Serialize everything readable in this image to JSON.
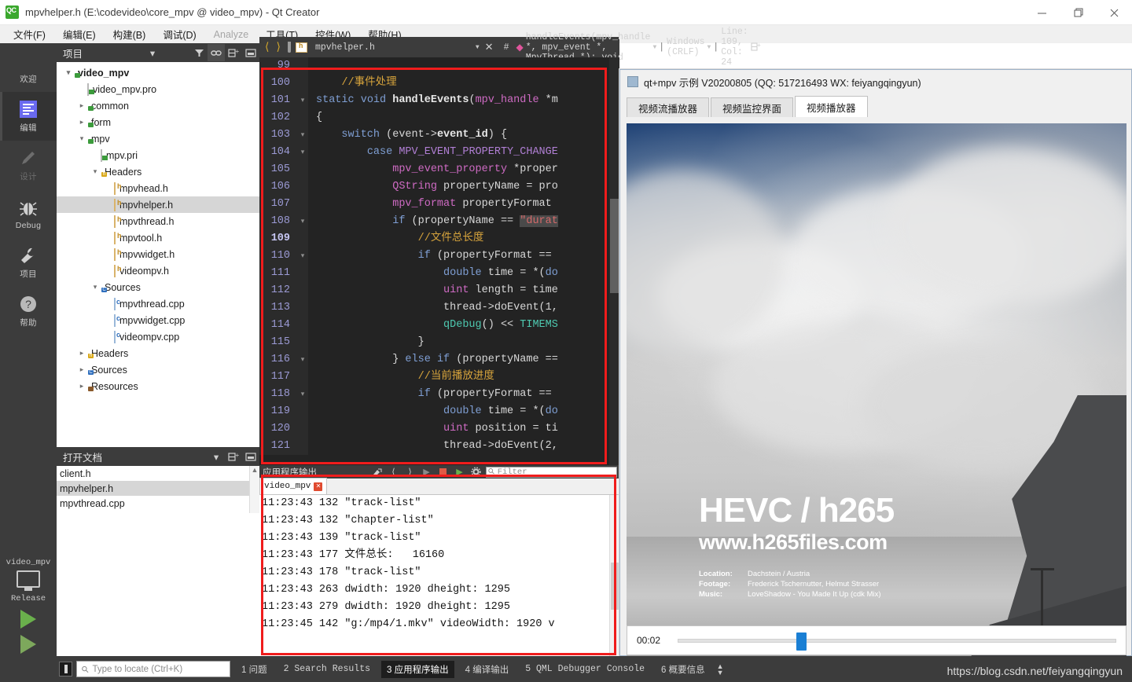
{
  "window": {
    "title": "mpvhelper.h (E:\\codevideo\\core_mpv @ video_mpv) - Qt Creator",
    "minimize": "—",
    "maximize": "❐",
    "close": "✕"
  },
  "menubar": [
    {
      "label": "文件(F)",
      "disabled": false
    },
    {
      "label": "编辑(E)",
      "disabled": false
    },
    {
      "label": "构建(B)",
      "disabled": false
    },
    {
      "label": "调试(D)",
      "disabled": false
    },
    {
      "label": "Analyze",
      "disabled": true
    },
    {
      "label": "工具(T)",
      "disabled": false
    },
    {
      "label": "控件(W)",
      "disabled": false
    },
    {
      "label": "帮助(H)",
      "disabled": false
    }
  ],
  "modebar": {
    "items": [
      {
        "label": "欢迎",
        "icon": "grid-icon",
        "state": "normal"
      },
      {
        "label": "编辑",
        "icon": "edit-icon",
        "state": "active"
      },
      {
        "label": "设计",
        "icon": "pencil-icon",
        "state": "disabled"
      },
      {
        "label": "Debug",
        "icon": "bug-icon",
        "state": "normal"
      },
      {
        "label": "项目",
        "icon": "wrench-icon",
        "state": "normal"
      },
      {
        "label": "帮助",
        "icon": "question-icon",
        "state": "normal"
      }
    ],
    "kit_name": "video_mpv",
    "build_config": "Release"
  },
  "project_panel": {
    "title": "项目",
    "tree": [
      {
        "label": "video_mpv",
        "indent": 0,
        "arrow": "down",
        "icon": "folder-pro",
        "bold": true,
        "selected": false
      },
      {
        "label": "video_mpv.pro",
        "indent": 1,
        "arrow": "",
        "icon": "doc-pro",
        "bold": false,
        "selected": false
      },
      {
        "label": "common",
        "indent": 1,
        "arrow": "right",
        "icon": "folder-pro",
        "bold": false,
        "selected": false
      },
      {
        "label": "form",
        "indent": 1,
        "arrow": "right",
        "icon": "folder-pro",
        "bold": false,
        "selected": false
      },
      {
        "label": "mpv",
        "indent": 1,
        "arrow": "down",
        "icon": "folder-pro",
        "bold": false,
        "selected": false
      },
      {
        "label": "mpv.pri",
        "indent": 2,
        "arrow": "",
        "icon": "doc-pro",
        "bold": false,
        "selected": false
      },
      {
        "label": "Headers",
        "indent": 2,
        "arrow": "down",
        "icon": "folder-h",
        "bold": false,
        "selected": false
      },
      {
        "label": "mpvhead.h",
        "indent": 3,
        "arrow": "",
        "icon": "file-h",
        "bold": false,
        "selected": false
      },
      {
        "label": "mpvhelper.h",
        "indent": 3,
        "arrow": "",
        "icon": "file-h",
        "bold": false,
        "selected": true
      },
      {
        "label": "mpvthread.h",
        "indent": 3,
        "arrow": "",
        "icon": "file-h",
        "bold": false,
        "selected": false
      },
      {
        "label": "mpvtool.h",
        "indent": 3,
        "arrow": "",
        "icon": "file-h",
        "bold": false,
        "selected": false
      },
      {
        "label": "mpvwidget.h",
        "indent": 3,
        "arrow": "",
        "icon": "file-h",
        "bold": false,
        "selected": false
      },
      {
        "label": "videompv.h",
        "indent": 3,
        "arrow": "",
        "icon": "file-h",
        "bold": false,
        "selected": false
      },
      {
        "label": "Sources",
        "indent": 2,
        "arrow": "down",
        "icon": "folder-cpp",
        "bold": false,
        "selected": false
      },
      {
        "label": "mpvthread.cpp",
        "indent": 3,
        "arrow": "",
        "icon": "file-cpp",
        "bold": false,
        "selected": false
      },
      {
        "label": "mpvwidget.cpp",
        "indent": 3,
        "arrow": "",
        "icon": "file-cpp",
        "bold": false,
        "selected": false
      },
      {
        "label": "videompv.cpp",
        "indent": 3,
        "arrow": "",
        "icon": "file-cpp",
        "bold": false,
        "selected": false
      },
      {
        "label": "Headers",
        "indent": 1,
        "arrow": "right",
        "icon": "folder-h",
        "bold": false,
        "selected": false
      },
      {
        "label": "Sources",
        "indent": 1,
        "arrow": "right",
        "icon": "folder-cpp",
        "bold": false,
        "selected": false
      },
      {
        "label": "Resources",
        "indent": 1,
        "arrow": "right",
        "icon": "folder-res",
        "bold": false,
        "selected": false
      }
    ]
  },
  "open_documents": {
    "title": "打开文档",
    "items": [
      {
        "label": "client.h",
        "selected": false
      },
      {
        "label": "mpvhelper.h",
        "selected": true
      },
      {
        "label": "mpvthread.cpp",
        "selected": false
      }
    ]
  },
  "editor": {
    "filename": "mpvhelper.h",
    "symbol": "handleEvents(mpv_handle *, mpv_event *, MpvThread *): void",
    "line_ending": "Windows (CRLF)",
    "cursor": "Line: 109, Col: 24",
    "lines": [
      {
        "n": "99",
        "fold": "",
        "cur": false,
        "html": ""
      },
      {
        "n": "100",
        "fold": "",
        "cur": false,
        "html": "    <span class=\"cm\">//事件处理</span>"
      },
      {
        "n": "101",
        "fold": "-",
        "cur": false,
        "html": "<span class=\"k\">static</span> <span class=\"k\">void</span> <span class=\"fn\">handleEvents</span>(<span class=\"ty\">mpv_handle</span> *m"
      },
      {
        "n": "102",
        "fold": "",
        "cur": false,
        "html": "{"
      },
      {
        "n": "103",
        "fold": "-",
        "cur": false,
        "html": "    <span class=\"k\">switch</span> (event-&gt;<span class=\"fn\">event_id</span>) {"
      },
      {
        "n": "104",
        "fold": "-",
        "cur": false,
        "html": "        <span class=\"k\">case</span> <span class=\"en\">MPV_EVENT_PROPERTY_CHANGE</span>"
      },
      {
        "n": "105",
        "fold": "",
        "cur": false,
        "html": "            <span class=\"ty\">mpv_event_property</span> *proper"
      },
      {
        "n": "106",
        "fold": "",
        "cur": false,
        "html": "            <span class=\"ty\">QString</span> propertyName = pro"
      },
      {
        "n": "107",
        "fold": "",
        "cur": false,
        "html": "            <span class=\"ty\">mpv_format</span> propertyFormat"
      },
      {
        "n": "108",
        "fold": "-",
        "cur": false,
        "html": "            <span class=\"k\">if</span> (propertyName == <span class=\"st hl\">\"durat</span>"
      },
      {
        "n": "109",
        "fold": "",
        "cur": true,
        "html": "                <span class=\"cm\">//文件总长度</span>"
      },
      {
        "n": "110",
        "fold": "-",
        "cur": false,
        "html": "                <span class=\"k\">if</span> (propertyFormat =="
      },
      {
        "n": "111",
        "fold": "",
        "cur": false,
        "html": "                    <span class=\"k\">double</span> time = *(<span class=\"k\">do</span>"
      },
      {
        "n": "112",
        "fold": "",
        "cur": false,
        "html": "                    <span class=\"ty\">uint</span> length = time"
      },
      {
        "n": "113",
        "fold": "",
        "cur": false,
        "html": "                    thread-&gt;doEvent(<span class=\"num\">1</span>,"
      },
      {
        "n": "114",
        "fold": "",
        "cur": false,
        "html": "                    <span class=\"qd\">qDebug</span>() &lt;&lt; <span class=\"qd\">TIMEMS</span>"
      },
      {
        "n": "115",
        "fold": "",
        "cur": false,
        "html": "                }"
      },
      {
        "n": "116",
        "fold": "-",
        "cur": false,
        "html": "            } <span class=\"k\">else</span> <span class=\"k\">if</span> (propertyName =="
      },
      {
        "n": "117",
        "fold": "",
        "cur": false,
        "html": "                <span class=\"cm\">//当前播放进度</span>"
      },
      {
        "n": "118",
        "fold": "-",
        "cur": false,
        "html": "                <span class=\"k\">if</span> (propertyFormat =="
      },
      {
        "n": "119",
        "fold": "",
        "cur": false,
        "html": "                    <span class=\"k\">double</span> time = *(<span class=\"k\">do</span>"
      },
      {
        "n": "120",
        "fold": "",
        "cur": false,
        "html": "                    <span class=\"ty\">uint</span> position = ti"
      },
      {
        "n": "121",
        "fold": "",
        "cur": false,
        "html": "                    thread-&gt;doEvent(<span class=\"num\">2</span>,"
      }
    ]
  },
  "output_pane": {
    "title": "应用程序输出",
    "filter_placeholder": "Filter",
    "tab_label": "video_mpv",
    "lines": [
      "11:23:43 132 \"track-list\"",
      "11:23:43 132 \"chapter-list\"",
      "11:23:43 139 \"track-list\"",
      "11:23:43 177 文件总长:   16160",
      "11:23:43 178 \"track-list\"",
      "11:23:43 263 dwidth: 1920 dheight: 1295",
      "11:23:43 279 dwidth: 1920 dheight: 1295",
      "11:23:45 142 \"g:/mp4/1.mkv\" videoWidth: 1920 v"
    ]
  },
  "player": {
    "title": "qt+mpv 示例 V20200805 (QQ: 517216493 WX: feiyangqingyun)",
    "tabs": [
      {
        "label": "视频流播放器",
        "active": false
      },
      {
        "label": "视频监控界面",
        "active": false
      },
      {
        "label": "视频播放器",
        "active": true
      }
    ],
    "overlay": {
      "line1": "HEVC / h265",
      "line2": "www.h265files.com",
      "meta": [
        {
          "key": "Location:",
          "value": "Dachstein / Austria"
        },
        {
          "key": "Footage:",
          "value": "Frederick Tschernutter, Helmut Strasser"
        },
        {
          "key": "Music:",
          "value": "LoveShadow - You Made It Up (cdk Mix)"
        }
      ]
    },
    "time": "00:02",
    "progress_percent": 27
  },
  "statusbar": {
    "locate_placeholder": "Type to locate (Ctrl+K)",
    "items": [
      {
        "label": "1 问题",
        "active": false,
        "cjk": true
      },
      {
        "label": "2 Search Results",
        "active": false,
        "cjk": false
      },
      {
        "label": "3 应用程序输出",
        "active": true,
        "cjk": true
      },
      {
        "label": "4 编译输出",
        "active": false,
        "cjk": true
      },
      {
        "label": "5 QML Debugger Console",
        "active": false,
        "cjk": false
      },
      {
        "label": "6 概要信息",
        "active": false,
        "cjk": true
      }
    ],
    "watermark": "https://blog.csdn.net/feiyangqingyun"
  },
  "colors": {
    "accent_blue": "#1a7fd4",
    "annotation_red": "#f01c1c",
    "chrome_dark": "#3c3c3c",
    "editor_bg": "#232323"
  }
}
